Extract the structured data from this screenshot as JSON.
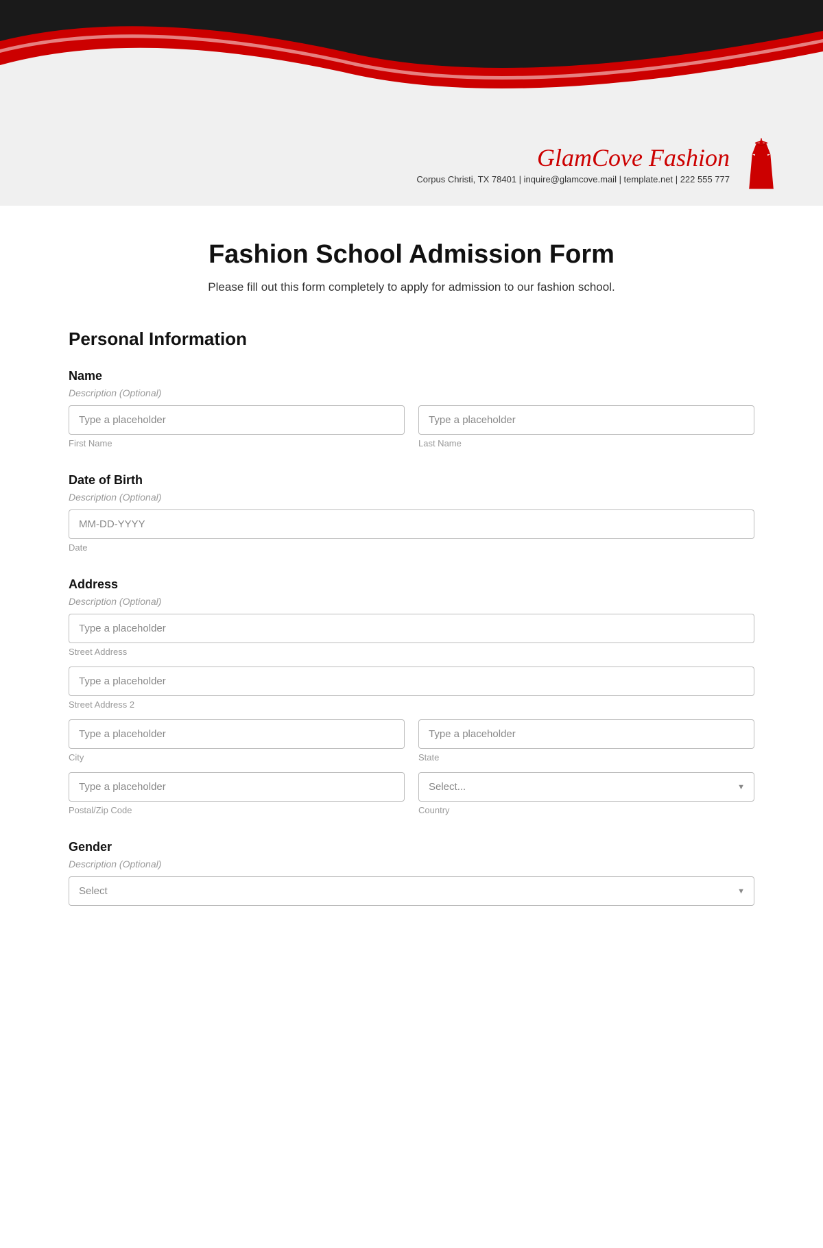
{
  "header": {
    "brand": "GlamCove Fashion",
    "contact": "Corpus Christi, TX 78401 | inquire@glamcove.mail | template.net | 222 555 777"
  },
  "form": {
    "title": "Fashion School Admission Form",
    "subtitle": "Please fill out this form completely to apply for admission to our fashion school.",
    "sections": [
      {
        "id": "personal-information",
        "title": "Personal Information"
      }
    ],
    "fields": {
      "name": {
        "label": "Name",
        "description": "Description (Optional)",
        "first_placeholder": "Type a placeholder",
        "last_placeholder": "Type a placeholder",
        "first_sublabel": "First Name",
        "last_sublabel": "Last Name"
      },
      "dob": {
        "label": "Date of Birth",
        "description": "Description (Optional)",
        "placeholder": "MM-DD-YYYY",
        "sublabel": "Date"
      },
      "address": {
        "label": "Address",
        "description": "Description (Optional)",
        "street1_placeholder": "Type a placeholder",
        "street1_sublabel": "Street Address",
        "street2_placeholder": "Type a placeholder",
        "street2_sublabel": "Street Address 2",
        "city_placeholder": "Type a placeholder",
        "city_sublabel": "City",
        "state_placeholder": "Type a placeholder",
        "state_sublabel": "State",
        "zip_placeholder": "Type a placeholder",
        "zip_sublabel": "Postal/Zip Code",
        "country_placeholder": "Select...",
        "country_sublabel": "Country"
      },
      "gender": {
        "label": "Gender",
        "description": "Description (Optional)",
        "select_placeholder": "Select",
        "select_sublabel": ""
      }
    }
  }
}
